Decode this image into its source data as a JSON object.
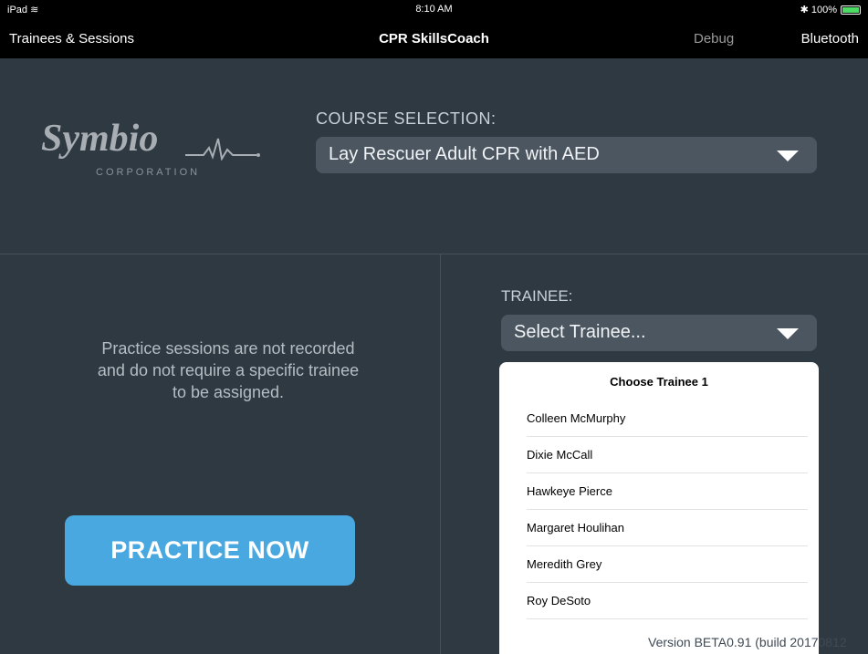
{
  "status_bar": {
    "device": "iPad",
    "time": "8:10 AM",
    "battery": "100%"
  },
  "nav": {
    "left": "Trainees & Sessions",
    "title": "CPR SkillsCoach",
    "debug": "Debug",
    "bluetooth": "Bluetooth"
  },
  "logo": {
    "name": "Symbio",
    "sub": "CORPORATION"
  },
  "course": {
    "label": "COURSE SELECTION:",
    "selected": "Lay Rescuer Adult CPR with AED"
  },
  "trainee": {
    "label": "TRAINEE:",
    "selected": "Select Trainee..."
  },
  "practice": {
    "note": "Practice sessions are not recorded and do not require a specific trainee to be assigned.",
    "button": "PRACTICE NOW"
  },
  "popover": {
    "title": "Choose Trainee 1",
    "items": [
      "Colleen McMurphy",
      "Dixie McCall",
      "Hawkeye Pierce",
      "Margaret Houlihan",
      "Meredith Grey",
      "Roy DeSoto"
    ]
  },
  "version": "Version BETA0.91 (build 20170812"
}
